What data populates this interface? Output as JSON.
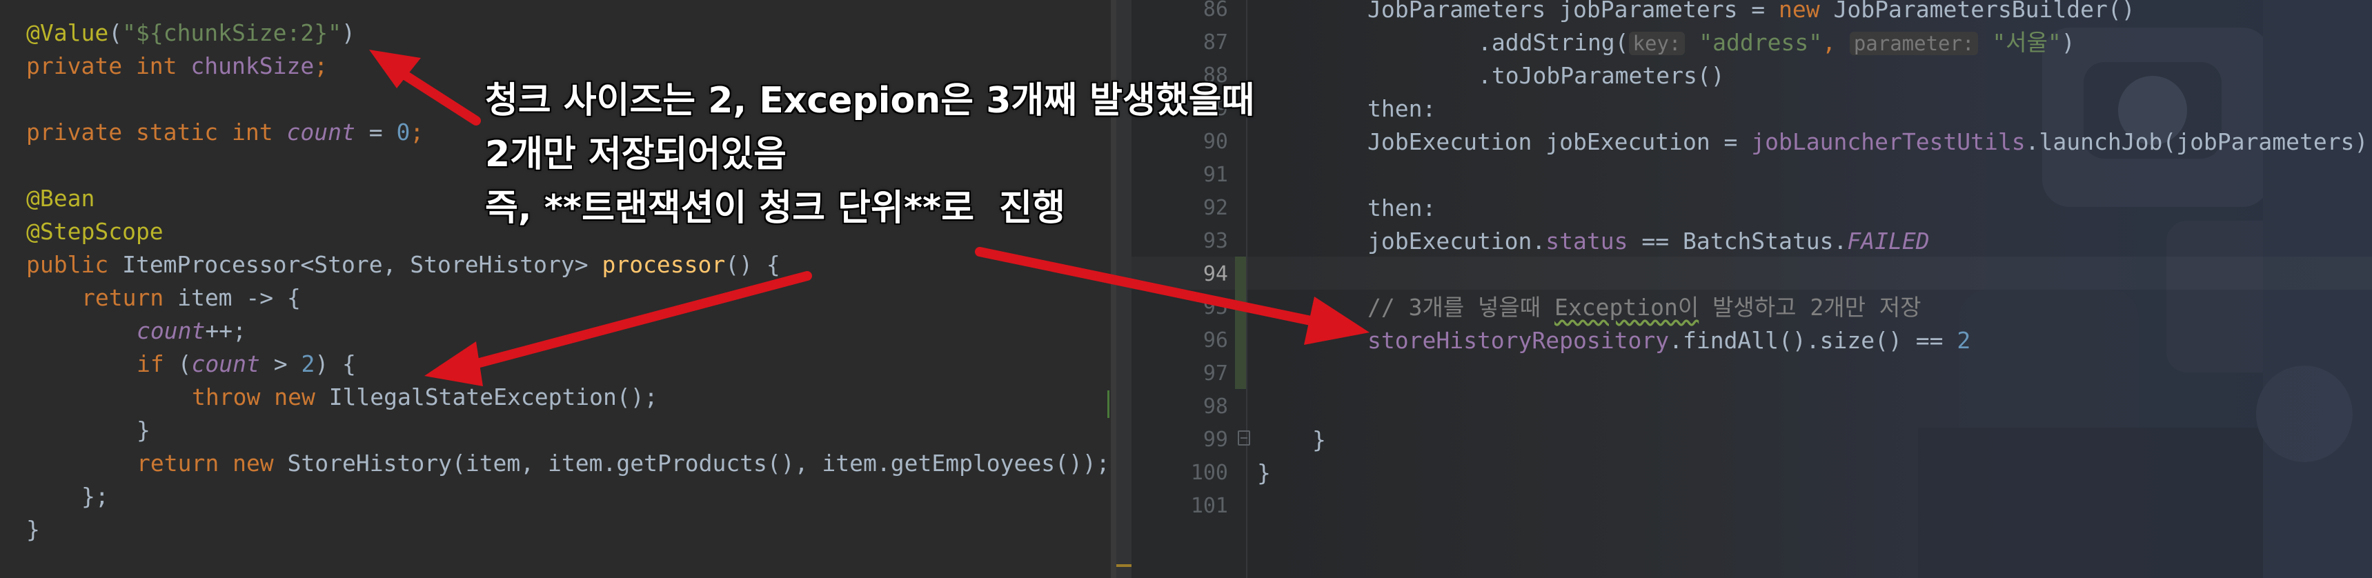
{
  "left_editor": {
    "lines": {
      "l1": {
        "annotation": "@Value",
        "open": "(",
        "string": "\"${chunkSize:2}\"",
        "close": ")"
      },
      "l2": {
        "kw": "private int ",
        "field": "chunkSize",
        "end": ";"
      },
      "l4": {
        "kw": "private static int ",
        "field": "count",
        "eq": " = ",
        "num": "0",
        "end": ";"
      },
      "l6": {
        "annotation": "@Bean"
      },
      "l7": {
        "annotation": "@StepScope"
      },
      "l8": {
        "kw": "public ",
        "type": "ItemProcessor<Store, StoreHistory> ",
        "fn": "processor",
        "end": "() {"
      },
      "l9": {
        "kw": "return ",
        "rest": "item -> {"
      },
      "l10": {
        "field": "count",
        "rest": "++;"
      },
      "l11": {
        "kw": "if ",
        "open": "(",
        "field": "count",
        "cmp": " > ",
        "num": "2",
        "close": ") {"
      },
      "l12": {
        "kw": "throw new ",
        "rest": "IllegalStateException();"
      },
      "l13": {
        "rest": "}"
      },
      "l14": {
        "kw": "return new ",
        "rest": "StoreHistory(item, item.getProducts(), item.getEmployees());"
      },
      "l15": {
        "rest": "};"
      },
      "l16": {
        "rest": "}"
      }
    }
  },
  "right_editor": {
    "line_numbers": [
      "86",
      "87",
      "88",
      "89",
      "90",
      "91",
      "92",
      "93",
      "94",
      "95",
      "96",
      "97",
      "98",
      "99",
      "100",
      "101"
    ],
    "lines": {
      "r86": {
        "type": "JobParameters ",
        "var": "jobParameters = ",
        "kw": "new ",
        "rest": "JobParametersBuilder()"
      },
      "r87": {
        "pre": ".addString(",
        "hint1": "key:",
        "str1": "\"address\"",
        "comma": ", ",
        "hint2": "parameter:",
        "str2": "\"서울\"",
        "end": ")"
      },
      "r88": {
        "pre": ".toJobParameters()"
      },
      "r89": {
        "label": "then:"
      },
      "r90": {
        "pre": "JobExecution jobExecution = ",
        "field": "jobLauncherTestUtils",
        "rest": ".launchJob(jobParameters)"
      },
      "r92": {
        "label": "then:"
      },
      "r93": {
        "pre": "jobExecution.",
        "field": "status",
        "op": " == BatchStatus.",
        "const": "FAILED"
      },
      "r95": {
        "comment_pre": "// 3개를 넣을때 ",
        "comment_sq": "Exception이",
        "comment_post": " 발생하고 2개만 저장"
      },
      "r96": {
        "field": "storeHistoryRepository",
        "rest": ".findAll().size() == ",
        "num": "2"
      },
      "r99": {
        "rest": "}"
      },
      "r100": {
        "rest": "}"
      }
    }
  },
  "overlay": {
    "line1_a": "청크 사이즈는 ",
    "line1_b": "2, Excepion",
    "line1_c": "은 ",
    "line1_d": "3",
    "line1_e": "개째 발생했을때",
    "line2_a": "2",
    "line2_b": "개만 저장되어있음",
    "line3": "즉, **트랜잭션이 청크 단위**로  진행"
  },
  "colors": {
    "annotation_arrow": "#e8141c",
    "keyword": "#cc7832",
    "string": "#6a8759",
    "annotation": "#bbb529",
    "field": "#9876aa"
  }
}
